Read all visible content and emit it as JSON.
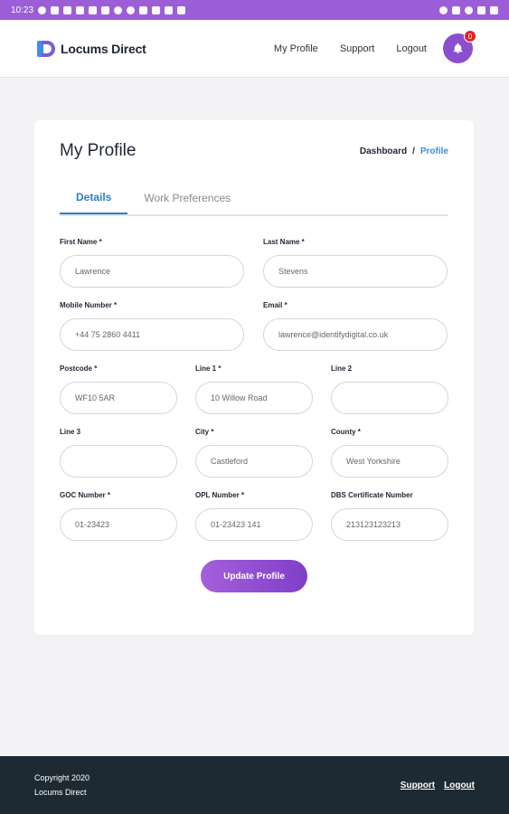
{
  "status_bar": {
    "time": "10:23"
  },
  "header": {
    "logo_text": "Locums Direct",
    "nav": {
      "my_profile": "My Profile",
      "support": "Support",
      "logout": "Logout"
    },
    "notification_count": "0"
  },
  "page": {
    "title": "My Profile",
    "breadcrumb": {
      "dashboard": "Dashboard",
      "separator": "/",
      "current": "Profile"
    },
    "tabs": {
      "details": "Details",
      "work_preferences": "Work Preferences"
    }
  },
  "form": {
    "first_name": {
      "label": "First Name *",
      "value": "Lawrence"
    },
    "last_name": {
      "label": "Last Name *",
      "value": "Stevens"
    },
    "mobile": {
      "label": "Mobile Number *",
      "value": "+44 75 2860 4411"
    },
    "email": {
      "label": "Email *",
      "value": "lawrence@identifydigital.co.uk"
    },
    "postcode": {
      "label": "Postcode *",
      "value": "WF10 5AR"
    },
    "line1": {
      "label": "Line 1 *",
      "value": "10 Willow Road"
    },
    "line2": {
      "label": "Line 2",
      "value": ""
    },
    "line3": {
      "label": "Line 3",
      "value": ""
    },
    "city": {
      "label": "City *",
      "value": "Castleford"
    },
    "county": {
      "label": "County *",
      "value": "West Yorkshire"
    },
    "goc": {
      "label": "GOC Number *",
      "value": "01-23423"
    },
    "opl": {
      "label": "OPL Number *",
      "value": "01-23423 141"
    },
    "dbs": {
      "label": "DBS Certificate Number",
      "value": "213123123213"
    },
    "submit": "Update Profile"
  },
  "footer": {
    "copyright_line1": "Copyright 2020",
    "copyright_line2": "Locums Direct",
    "support": "Support",
    "logout": "Logout"
  },
  "colors": {
    "brand_purple": "#8a4fcf",
    "accent_blue": "#2a7fc9",
    "footer_bg": "#1e2a33"
  },
  "icons": {
    "notification": "bell-icon"
  }
}
